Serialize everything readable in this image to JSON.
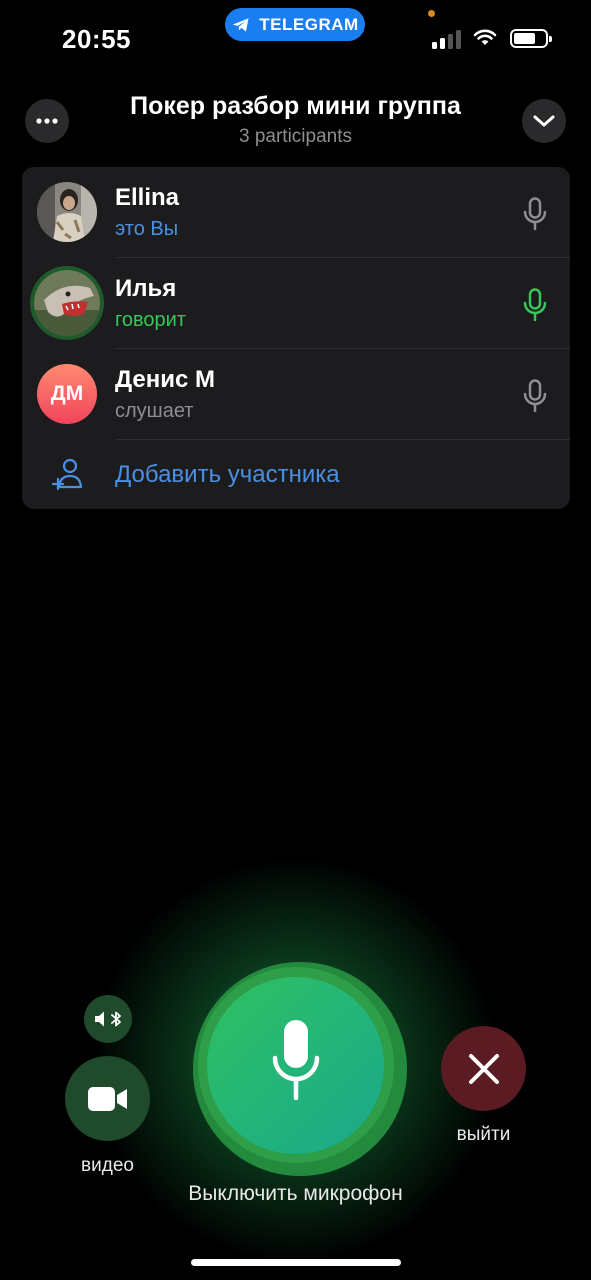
{
  "status_bar": {
    "time": "20:55",
    "app_pill": "TELEGRAM",
    "signal_bars": 2,
    "signal_total": 4,
    "battery_fraction": 0.7
  },
  "header": {
    "title": "Покер разбор мини группа",
    "subtitle": "3 participants",
    "more_icon": "ellipsis-icon",
    "collapse_icon": "chevron-down-icon"
  },
  "participants": [
    {
      "name": "Ellina",
      "status": "это Вы",
      "status_color": "#4a90e2",
      "mic_color": "#8e8e93",
      "avatar_type": "photo"
    },
    {
      "name": "Илья",
      "status": "говорит",
      "status_color": "#34c759",
      "mic_color": "#34c759",
      "avatar_type": "photo",
      "speaking": true
    },
    {
      "name": "Денис М",
      "status": "слушает",
      "status_color": "#8e8e93",
      "mic_color": "#8e8e93",
      "avatar_type": "initials",
      "initials": "ДМ"
    }
  ],
  "add_participant": {
    "label": "Добавить участника",
    "icon": "add-user-icon",
    "color": "#4a90e2"
  },
  "controls": {
    "audio_output_icon": "speaker-bluetooth-icon",
    "video_label": "видео",
    "mute_label": "Выключить микрофон",
    "leave_label": "выйти"
  },
  "colors": {
    "accent_blue": "#4a90e2",
    "speaking_green": "#34c759",
    "leave_red": "#5a1c22",
    "card_bg": "#1c1c1e"
  }
}
